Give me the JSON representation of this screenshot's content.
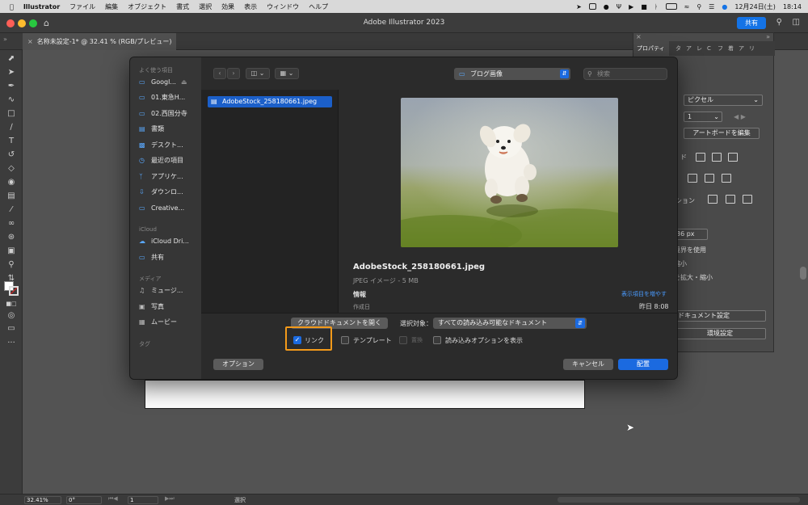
{
  "menubar": {
    "app": "Illustrator",
    "items": [
      "ファイル",
      "編集",
      "オブジェクト",
      "書式",
      "選択",
      "効果",
      "表示",
      "ウィンドウ",
      "ヘルプ"
    ],
    "date": "12月24日(土)",
    "time": "18:14"
  },
  "window": {
    "title": "Adobe Illustrator 2023",
    "share_label": "共有",
    "doc_tab": "名称未設定-1* @ 32.41 % (RGB/プレビュー)"
  },
  "panel": {
    "tabs": [
      "プロパティ",
      "タ",
      "ア",
      "レ",
      "C",
      "フ",
      "着",
      "ア",
      "リ"
    ],
    "units": "ピクセル",
    "artboard_num": "1",
    "edit_artboard": "アートボードを編集",
    "ruler_label": "ド",
    "align_label": "ション",
    "value": "36 px",
    "opt1": "境界を使用",
    "opt2": "縮小",
    "opt3": "を拡大・縮小",
    "doc_settings": "ドキュメント設定",
    "prefs": "環境設定"
  },
  "status": {
    "zoom": "32.41%",
    "angle": "0°",
    "page": "1",
    "tool": "選択"
  },
  "dialog": {
    "sidebar": {
      "favorites_header": "よく使う項目",
      "favorites": [
        {
          "icon": "folder-icon",
          "label": "Googl..."
        },
        {
          "icon": "folder-icon",
          "label": "01.東急H..."
        },
        {
          "icon": "folder-icon",
          "label": "02.西国分寺"
        },
        {
          "icon": "document-icon",
          "label": "書類"
        },
        {
          "icon": "desktop-icon",
          "label": "デスクト..."
        },
        {
          "icon": "clock-icon",
          "label": "最近の項目"
        },
        {
          "icon": "apps-icon",
          "label": "アプリケ..."
        },
        {
          "icon": "download-icon",
          "label": "ダウンロ..."
        },
        {
          "icon": "folder-icon",
          "label": "Creative..."
        }
      ],
      "icloud_header": "iCloud",
      "icloud": [
        {
          "icon": "cloud-icon",
          "label": "iCloud Dri..."
        },
        {
          "icon": "shared-folder-icon",
          "label": "共有"
        }
      ],
      "media_header": "メディア",
      "media": [
        {
          "icon": "music-icon",
          "label": "ミュージ..."
        },
        {
          "icon": "camera-icon",
          "label": "写真"
        },
        {
          "icon": "film-icon",
          "label": "ムービー"
        }
      ],
      "tags_header": "タグ"
    },
    "location": "ブログ画像",
    "search_placeholder": "検索",
    "selected_file": "AdobeStock_258180661.jpeg",
    "preview": {
      "name": "AdobeStock_258180661.jpeg",
      "kind": "JPEG イメージ - 5 MB",
      "info_label": "情報",
      "show_more": "表示項目を増やす",
      "created_label": "作成日",
      "created_value": "昨日 8:08"
    },
    "cloud_button": "クラウドドキュメントを開く",
    "enable_label": "選択対象：",
    "enable_value": "すべての読み込み可能なドキュメント",
    "link_label": "リンク",
    "template_label": "テンプレート",
    "replace_label": "置換",
    "show_import_label": "読み込みオプションを表示",
    "options_button": "オプション",
    "cancel_button": "キャンセル",
    "place_button": "配置"
  }
}
